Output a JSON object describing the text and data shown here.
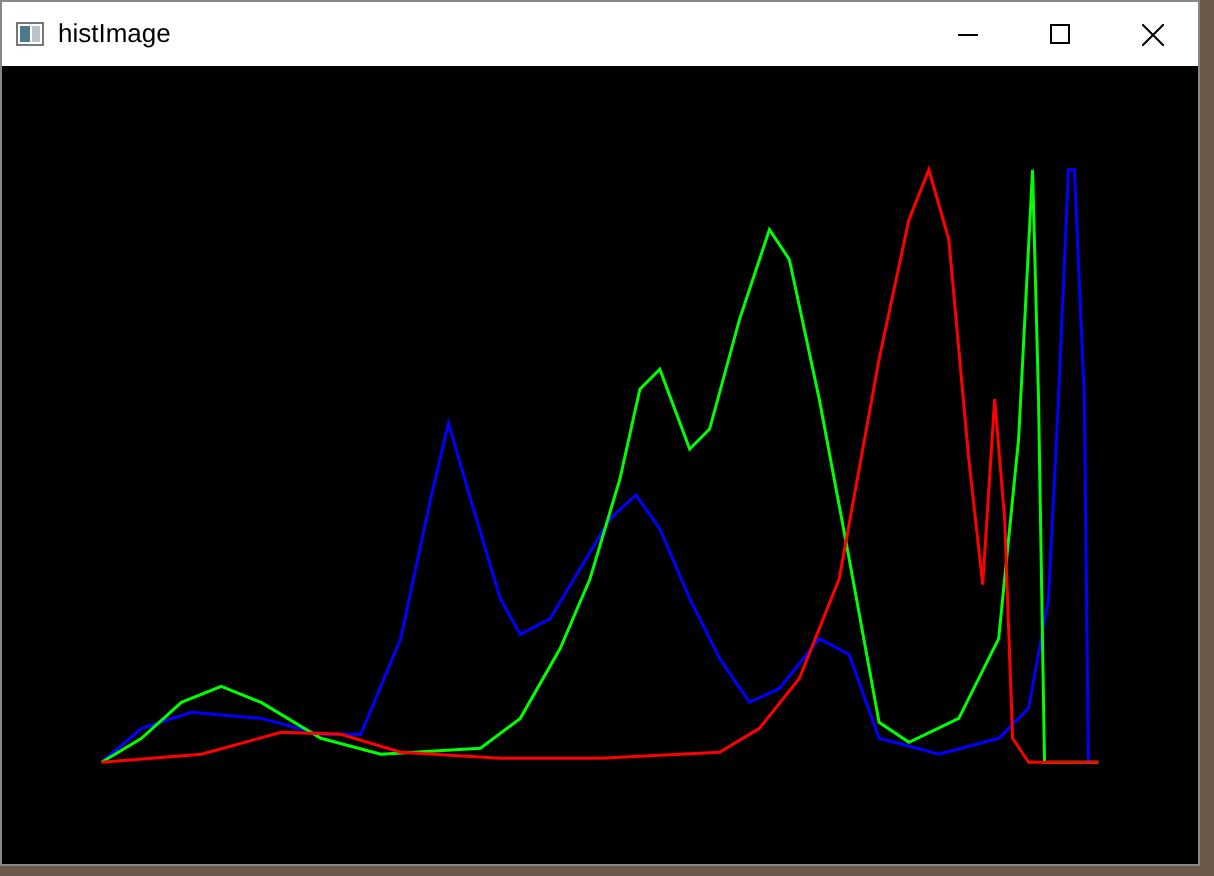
{
  "window": {
    "title": "histImage"
  }
}
